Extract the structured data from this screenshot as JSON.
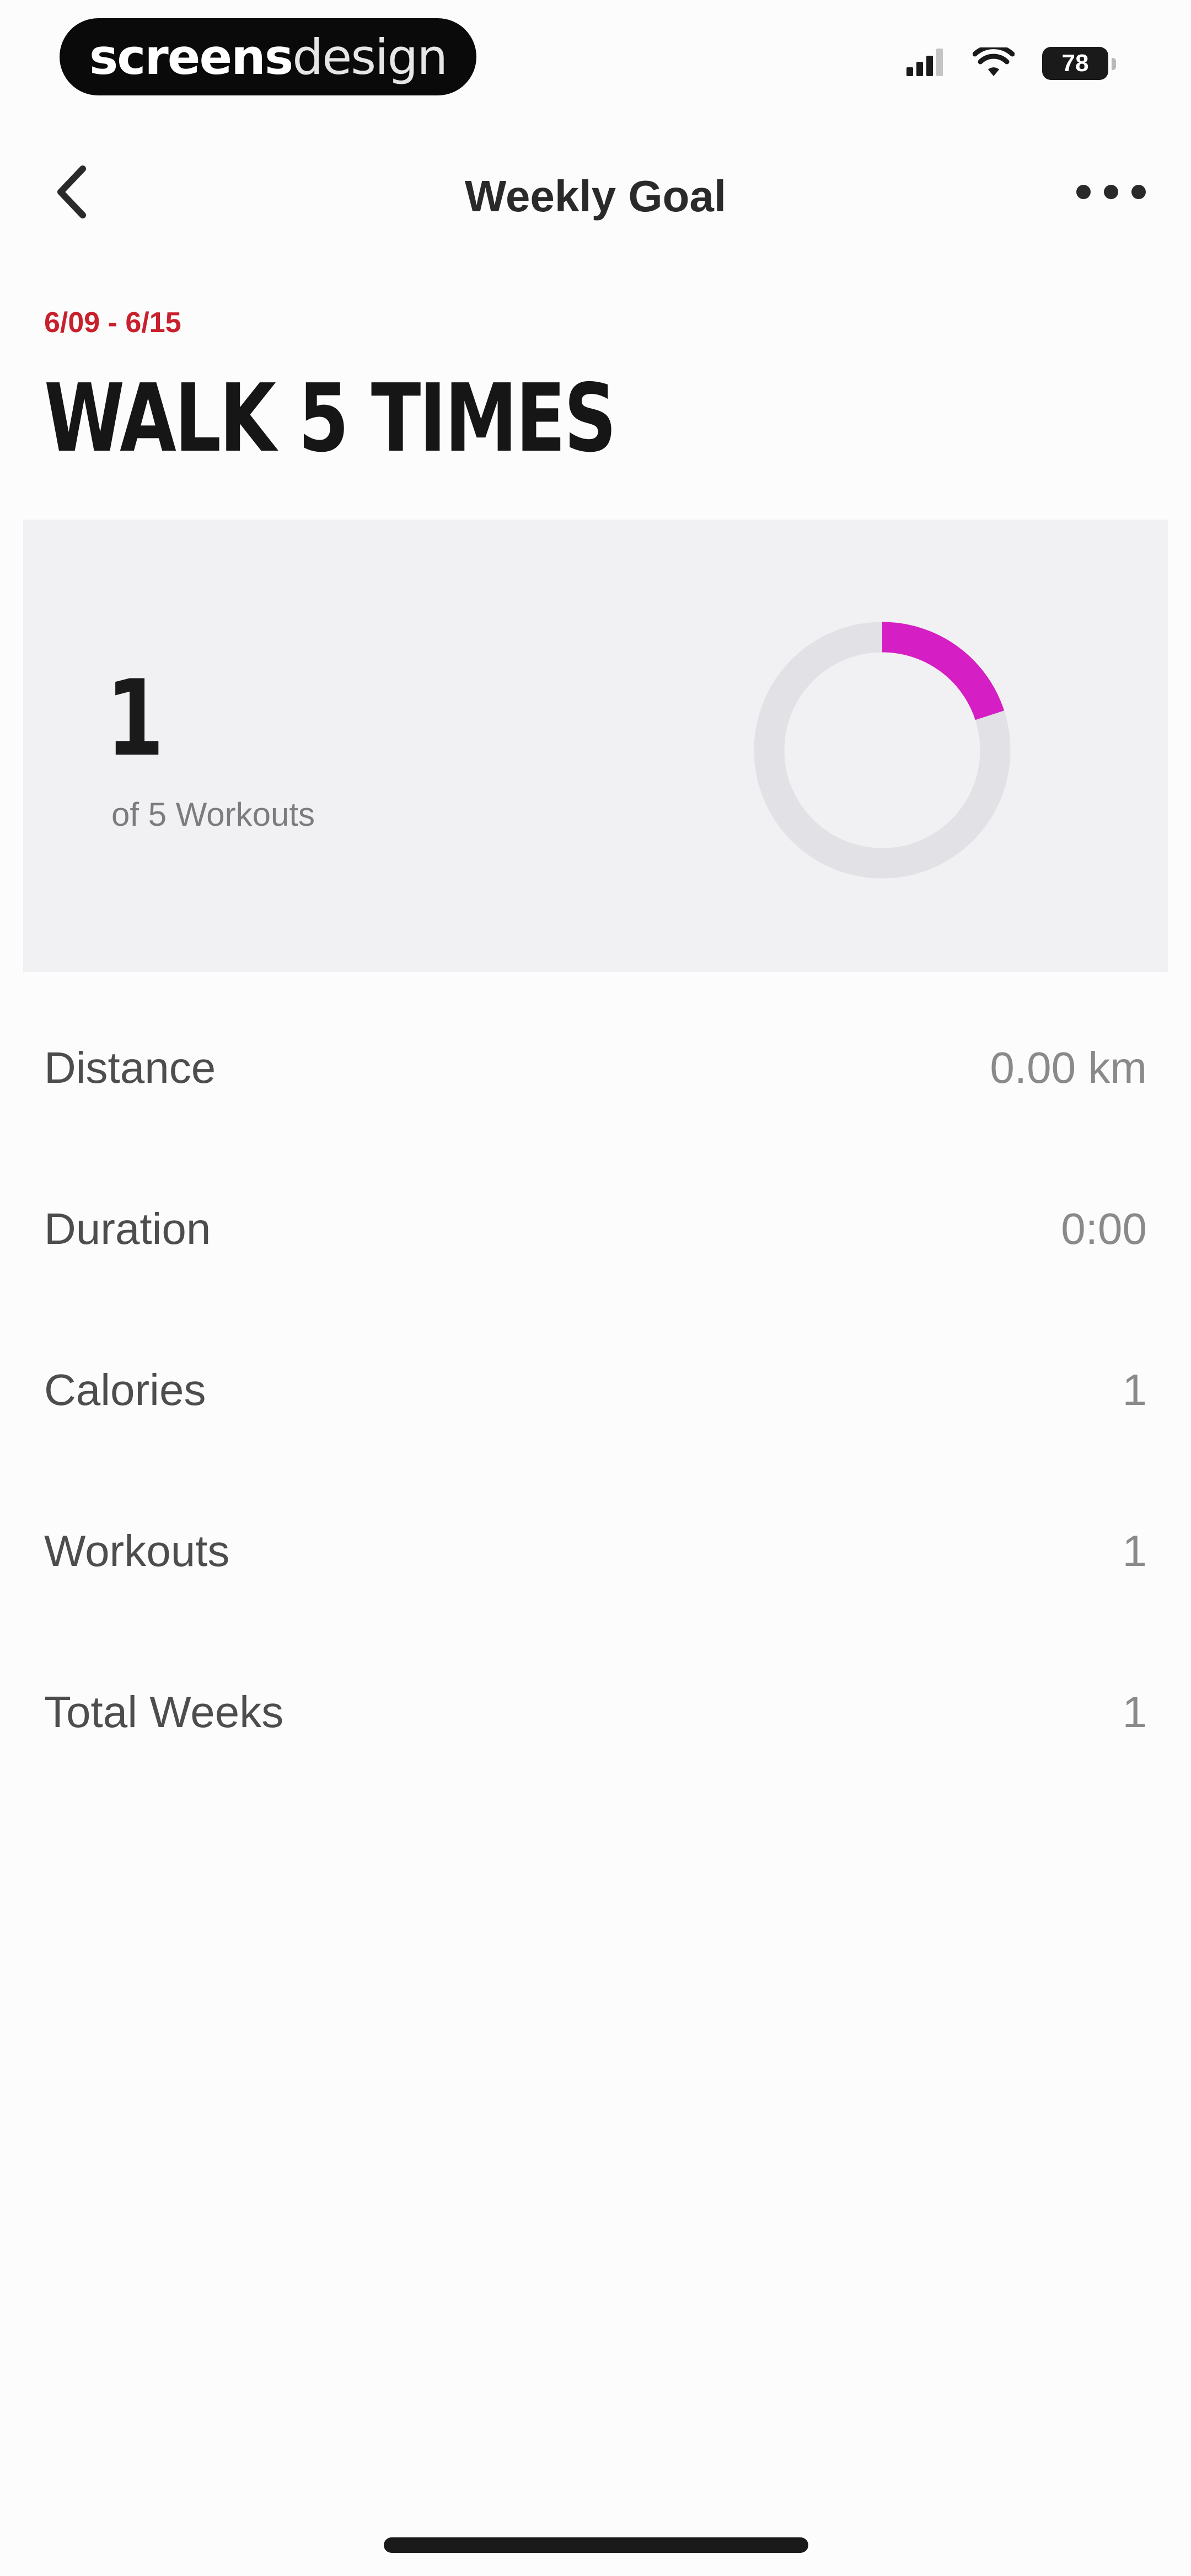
{
  "status_bar": {
    "brand_bold": "screens",
    "brand_light": "design",
    "battery_level": "78",
    "icons": [
      "signal-icon",
      "wifi-icon",
      "battery-icon"
    ]
  },
  "nav": {
    "title": "Weekly Goal",
    "back_icon": "chevron-left-icon",
    "more_icon": "more-horizontal-icon"
  },
  "goal": {
    "date_range": "6/09 - 6/15",
    "title": "WALK 5 TIMES"
  },
  "progress": {
    "count": "1",
    "caption": "of 5 Workouts",
    "completed": 1,
    "target": 5,
    "ring_color": "#d51ec3",
    "track_color": "#e2e1e6"
  },
  "stats": [
    {
      "label": "Distance",
      "value": "0.00 km"
    },
    {
      "label": "Duration",
      "value": "0:00"
    },
    {
      "label": "Calories",
      "value": "1"
    },
    {
      "label": "Workouts",
      "value": "1"
    },
    {
      "label": "Total Weeks",
      "value": "1"
    }
  ],
  "colors": {
    "accent_red": "#c8202c",
    "ring_magenta": "#d51ec3",
    "card_bg": "#f1f0f3"
  }
}
